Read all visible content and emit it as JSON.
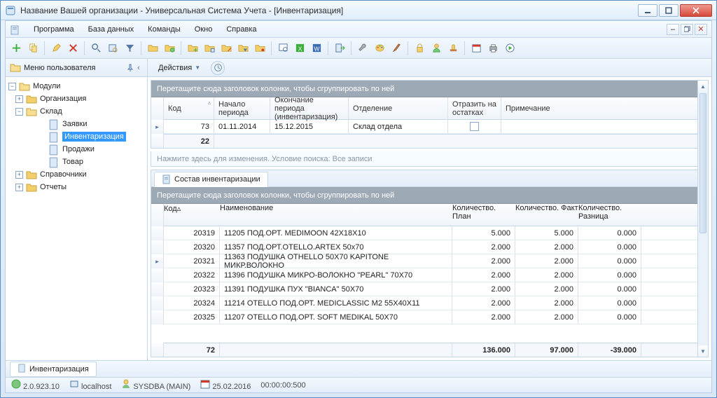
{
  "window": {
    "title": "Название Вашей организации - Универсальная Система Учета - [Инвентаризация]"
  },
  "menu": {
    "items": [
      "Программа",
      "База данных",
      "Команды",
      "Окно",
      "Справка"
    ]
  },
  "leftpane": {
    "header": "Меню пользователя",
    "tree": {
      "root": "Модули",
      "org": "Организация",
      "sklad": "Склад",
      "zayavki": "Заявки",
      "invent": "Инвентаризация",
      "prodazhi": "Продажи",
      "tovar": "Товар",
      "sprav": "Справочники",
      "otchety": "Отчеты"
    }
  },
  "actions": {
    "label": "Действия"
  },
  "groupbar_text": "Перетащите сюда заголовок колонки, чтобы сгруппировать по ней",
  "filterbar_text": "Нажмите здесь для изменения. Условие поиска: Все записи",
  "grid1": {
    "cols": [
      "Код",
      "Начало периода",
      "Окончание периода (инвентаризация)",
      "Отделение",
      "Отразить на остатках",
      "Примечание"
    ],
    "row": {
      "code": "73",
      "start": "01.11.2014",
      "end": "15.12.2015",
      "dept": "Склад отдела",
      "note": ""
    },
    "footer_code": "22"
  },
  "grid2": {
    "tab": "Состав инвентаризации",
    "cols": [
      "Код",
      "Наименование",
      "Количество. План",
      "Количество. Факт",
      "Количество. Разница"
    ],
    "rows": [
      {
        "code": "20319",
        "name": "11205 ПОД.ОРТ. MEDIMOON 42X18X10",
        "plan": "5.000",
        "fact": "5.000",
        "diff": "0.000"
      },
      {
        "code": "20320",
        "name": "11357 ПОД.ОРТ.OTELLO.ARTEX 50x70",
        "plan": "2.000",
        "fact": "2.000",
        "diff": "0.000"
      },
      {
        "code": "20321",
        "name": "11363 ПОДУШКА OTHELLO 50X70 KAPITONE МИКР.ВОЛОКНО",
        "plan": "2.000",
        "fact": "2.000",
        "diff": "0.000"
      },
      {
        "code": "20322",
        "name": "11396 ПОДУШКА МИКРО-ВОЛОКНО \"PEARL\" 70X70",
        "plan": "2.000",
        "fact": "2.000",
        "diff": "0.000"
      },
      {
        "code": "20323",
        "name": "11391 ПОДУШКА ПУХ \"BIANCA\" 50X70",
        "plan": "2.000",
        "fact": "2.000",
        "diff": "0.000"
      },
      {
        "code": "20324",
        "name": "11214 OTELLO ПОД.ОРТ. MEDICLASSIC M2 55X40X11",
        "plan": "2.000",
        "fact": "2.000",
        "diff": "0.000"
      },
      {
        "code": "20325",
        "name": "11207 OTELLO ПОД.ОРТ. SOFT MEDIKAL 50X70",
        "plan": "2.000",
        "fact": "2.000",
        "diff": "0.000"
      }
    ],
    "footer": {
      "code": "72",
      "plan": "136.000",
      "fact": "97.000",
      "diff": "-39.000"
    }
  },
  "tasktab": "Инвентаризация",
  "status": {
    "ver": "2.0.923.10",
    "host": "localhost",
    "user": "SYSDBA (MAIN)",
    "date": "25.02.2016",
    "time": "00:00:00:500"
  }
}
